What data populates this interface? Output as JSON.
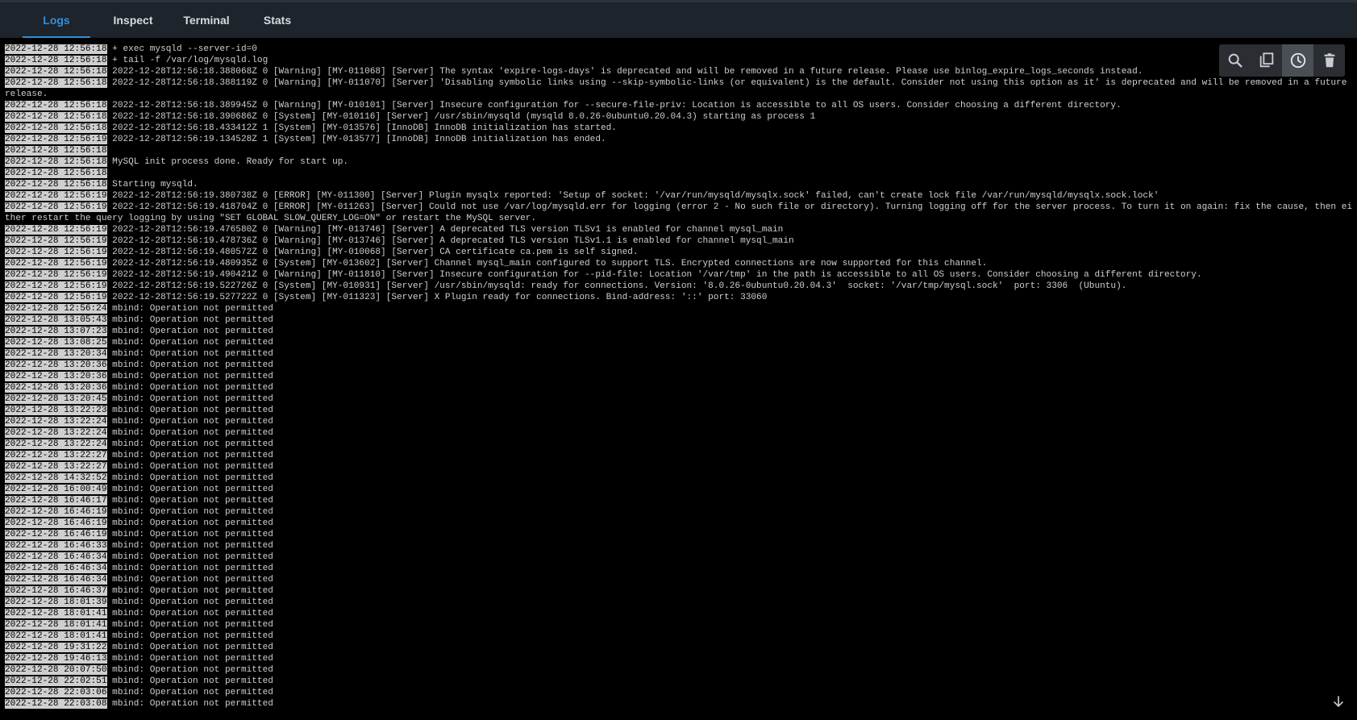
{
  "tabs": [
    {
      "label": "Logs",
      "active": true
    },
    {
      "label": "Inspect",
      "active": false
    },
    {
      "label": "Terminal",
      "active": false
    },
    {
      "label": "Stats",
      "active": false
    }
  ],
  "toolbar": {
    "icons": [
      "search-icon",
      "copy-icon",
      "clock-icon",
      "trash-icon"
    ],
    "active_icon": "clock-icon"
  },
  "colors": {
    "accent": "#2f8fe0",
    "background": "#000000",
    "tabbar": "#1e242b",
    "timestamp_bg": "#cfcfcf"
  },
  "logs": [
    {
      "ts": "2022-12-28 12:56:18",
      "msg": "+ exec mysqld --server-id=0"
    },
    {
      "ts": "2022-12-28 12:56:18",
      "msg": "+ tail -f /var/log/mysqld.log"
    },
    {
      "ts": "2022-12-28 12:56:18",
      "msg": "2022-12-28T12:56:18.388068Z 0 [Warning] [MY-011068] [Server] The syntax 'expire-logs-days' is deprecated and will be removed in a future release. Please use binlog_expire_logs_seconds instead."
    },
    {
      "ts": "2022-12-28 12:56:18",
      "msg": "2022-12-28T12:56:18.388119Z 0 [Warning] [MY-011070] [Server] 'Disabling symbolic links using --skip-symbolic-links (or equivalent) is the default. Consider not using this option as it' is deprecated and will be removed in a future release."
    },
    {
      "ts": "2022-12-28 12:56:18",
      "msg": "2022-12-28T12:56:18.389945Z 0 [Warning] [MY-010101] [Server] Insecure configuration for --secure-file-priv: Location is accessible to all OS users. Consider choosing a different directory."
    },
    {
      "ts": "2022-12-28 12:56:18",
      "msg": "2022-12-28T12:56:18.390686Z 0 [System] [MY-010116] [Server] /usr/sbin/mysqld (mysqld 8.0.26-0ubuntu0.20.04.3) starting as process 1"
    },
    {
      "ts": "2022-12-28 12:56:18",
      "msg": "2022-12-28T12:56:18.433412Z 1 [System] [MY-013576] [InnoDB] InnoDB initialization has started."
    },
    {
      "ts": "2022-12-28 12:56:19",
      "msg": "2022-12-28T12:56:19.134528Z 1 [System] [MY-013577] [InnoDB] InnoDB initialization has ended."
    },
    {
      "ts": "2022-12-28 12:56:18",
      "msg": ""
    },
    {
      "ts": "2022-12-28 12:56:18",
      "msg": "MySQL init process done. Ready for start up."
    },
    {
      "ts": "2022-12-28 12:56:18",
      "msg": ""
    },
    {
      "ts": "2022-12-28 12:56:18",
      "msg": "Starting mysqld."
    },
    {
      "ts": "2022-12-28 12:56:19",
      "msg": "2022-12-28T12:56:19.380738Z 0 [ERROR] [MY-011300] [Server] Plugin mysqlx reported: 'Setup of socket: '/var/run/mysqld/mysqlx.sock' failed, can't create lock file /var/run/mysqld/mysqlx.sock.lock'"
    },
    {
      "ts": "2022-12-28 12:56:19",
      "msg": "2022-12-28T12:56:19.418704Z 0 [ERROR] [MY-011263] [Server] Could not use /var/log/mysqld.err for logging (error 2 - No such file or directory). Turning logging off for the server process. To turn it on again: fix the cause, then either restart the query logging by using \"SET GLOBAL SLOW_QUERY_LOG=ON\" or restart the MySQL server."
    },
    {
      "ts": "2022-12-28 12:56:19",
      "msg": "2022-12-28T12:56:19.476580Z 0 [Warning] [MY-013746] [Server] A deprecated TLS version TLSv1 is enabled for channel mysql_main"
    },
    {
      "ts": "2022-12-28 12:56:19",
      "msg": "2022-12-28T12:56:19.478736Z 0 [Warning] [MY-013746] [Server] A deprecated TLS version TLSv1.1 is enabled for channel mysql_main"
    },
    {
      "ts": "2022-12-28 12:56:19",
      "msg": "2022-12-28T12:56:19.480572Z 0 [Warning] [MY-010068] [Server] CA certificate ca.pem is self signed."
    },
    {
      "ts": "2022-12-28 12:56:19",
      "msg": "2022-12-28T12:56:19.480935Z 0 [System] [MY-013602] [Server] Channel mysql_main configured to support TLS. Encrypted connections are now supported for this channel."
    },
    {
      "ts": "2022-12-28 12:56:19",
      "msg": "2022-12-28T12:56:19.490421Z 0 [Warning] [MY-011810] [Server] Insecure configuration for --pid-file: Location '/var/tmp' in the path is accessible to all OS users. Consider choosing a different directory."
    },
    {
      "ts": "2022-12-28 12:56:19",
      "msg": "2022-12-28T12:56:19.522726Z 0 [System] [MY-010931] [Server] /usr/sbin/mysqld: ready for connections. Version: '8.0.26-0ubuntu0.20.04.3'  socket: '/var/tmp/mysql.sock'  port: 3306  (Ubuntu)."
    },
    {
      "ts": "2022-12-28 12:56:19",
      "msg": "2022-12-28T12:56:19.527722Z 0 [System] [MY-011323] [Server] X Plugin ready for connections. Bind-address: '::' port: 33060"
    },
    {
      "ts": "2022-12-28 12:56:24",
      "msg": "mbind: Operation not permitted"
    },
    {
      "ts": "2022-12-28 13:05:43",
      "msg": "mbind: Operation not permitted"
    },
    {
      "ts": "2022-12-28 13:07:23",
      "msg": "mbind: Operation not permitted"
    },
    {
      "ts": "2022-12-28 13:08:25",
      "msg": "mbind: Operation not permitted"
    },
    {
      "ts": "2022-12-28 13:20:34",
      "msg": "mbind: Operation not permitted"
    },
    {
      "ts": "2022-12-28 13:20:36",
      "msg": "mbind: Operation not permitted"
    },
    {
      "ts": "2022-12-28 13:20:36",
      "msg": "mbind: Operation not permitted"
    },
    {
      "ts": "2022-12-28 13:20:36",
      "msg": "mbind: Operation not permitted"
    },
    {
      "ts": "2022-12-28 13:20:45",
      "msg": "mbind: Operation not permitted"
    },
    {
      "ts": "2022-12-28 13:22:23",
      "msg": "mbind: Operation not permitted"
    },
    {
      "ts": "2022-12-28 13:22:24",
      "msg": "mbind: Operation not permitted"
    },
    {
      "ts": "2022-12-28 13:22:24",
      "msg": "mbind: Operation not permitted"
    },
    {
      "ts": "2022-12-28 13:22:24",
      "msg": "mbind: Operation not permitted"
    },
    {
      "ts": "2022-12-28 13:22:27",
      "msg": "mbind: Operation not permitted"
    },
    {
      "ts": "2022-12-28 13:22:27",
      "msg": "mbind: Operation not permitted"
    },
    {
      "ts": "2022-12-28 14:32:52",
      "msg": "mbind: Operation not permitted"
    },
    {
      "ts": "2022-12-28 16:00:49",
      "msg": "mbind: Operation not permitted"
    },
    {
      "ts": "2022-12-28 16:46:17",
      "msg": "mbind: Operation not permitted"
    },
    {
      "ts": "2022-12-28 16:46:19",
      "msg": "mbind: Operation not permitted"
    },
    {
      "ts": "2022-12-28 16:46:19",
      "msg": "mbind: Operation not permitted"
    },
    {
      "ts": "2022-12-28 16:46:19",
      "msg": "mbind: Operation not permitted"
    },
    {
      "ts": "2022-12-28 16:46:33",
      "msg": "mbind: Operation not permitted"
    },
    {
      "ts": "2022-12-28 16:46:34",
      "msg": "mbind: Operation not permitted"
    },
    {
      "ts": "2022-12-28 16:46:34",
      "msg": "mbind: Operation not permitted"
    },
    {
      "ts": "2022-12-28 16:46:34",
      "msg": "mbind: Operation not permitted"
    },
    {
      "ts": "2022-12-28 16:46:37",
      "msg": "mbind: Operation not permitted"
    },
    {
      "ts": "2022-12-28 18:01:39",
      "msg": "mbind: Operation not permitted"
    },
    {
      "ts": "2022-12-28 18:01:41",
      "msg": "mbind: Operation not permitted"
    },
    {
      "ts": "2022-12-28 18:01:41",
      "msg": "mbind: Operation not permitted"
    },
    {
      "ts": "2022-12-28 18:01:41",
      "msg": "mbind: Operation not permitted"
    },
    {
      "ts": "2022-12-28 19:31:22",
      "msg": "mbind: Operation not permitted"
    },
    {
      "ts": "2022-12-28 19:46:13",
      "msg": "mbind: Operation not permitted"
    },
    {
      "ts": "2022-12-28 20:07:50",
      "msg": "mbind: Operation not permitted"
    },
    {
      "ts": "2022-12-28 22:02:51",
      "msg": "mbind: Operation not permitted"
    },
    {
      "ts": "2022-12-28 22:03:06",
      "msg": "mbind: Operation not permitted"
    },
    {
      "ts": "2022-12-28 22:03:08",
      "msg": "mbind: Operation not permitted"
    }
  ]
}
